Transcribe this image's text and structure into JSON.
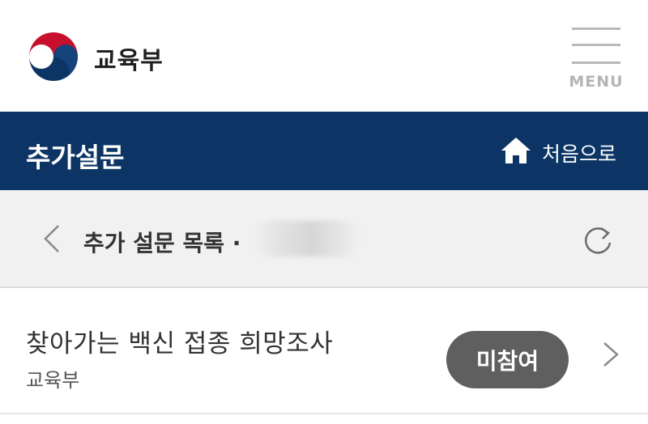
{
  "header": {
    "ministry_name": "교육부",
    "menu_label": "MENU"
  },
  "page": {
    "title": "추가설문",
    "home_label": "처음으로"
  },
  "sub_header": {
    "title": "추가 설문 목록 ·"
  },
  "surveys": [
    {
      "title": "찾아가는 백신 접종 희망조사",
      "organization": "교육부",
      "status": "미참여"
    }
  ],
  "colors": {
    "brand_navy": "#0c3566",
    "badge_gray": "#5f5f5f",
    "sub_header_bg": "#f1f1f1"
  },
  "icons": {
    "logo": "taegeuk-logo-icon",
    "menu": "hamburger-menu-icon",
    "home": "home-icon",
    "back": "chevron-left-icon",
    "refresh": "refresh-icon",
    "row_arrow": "chevron-right-icon"
  }
}
